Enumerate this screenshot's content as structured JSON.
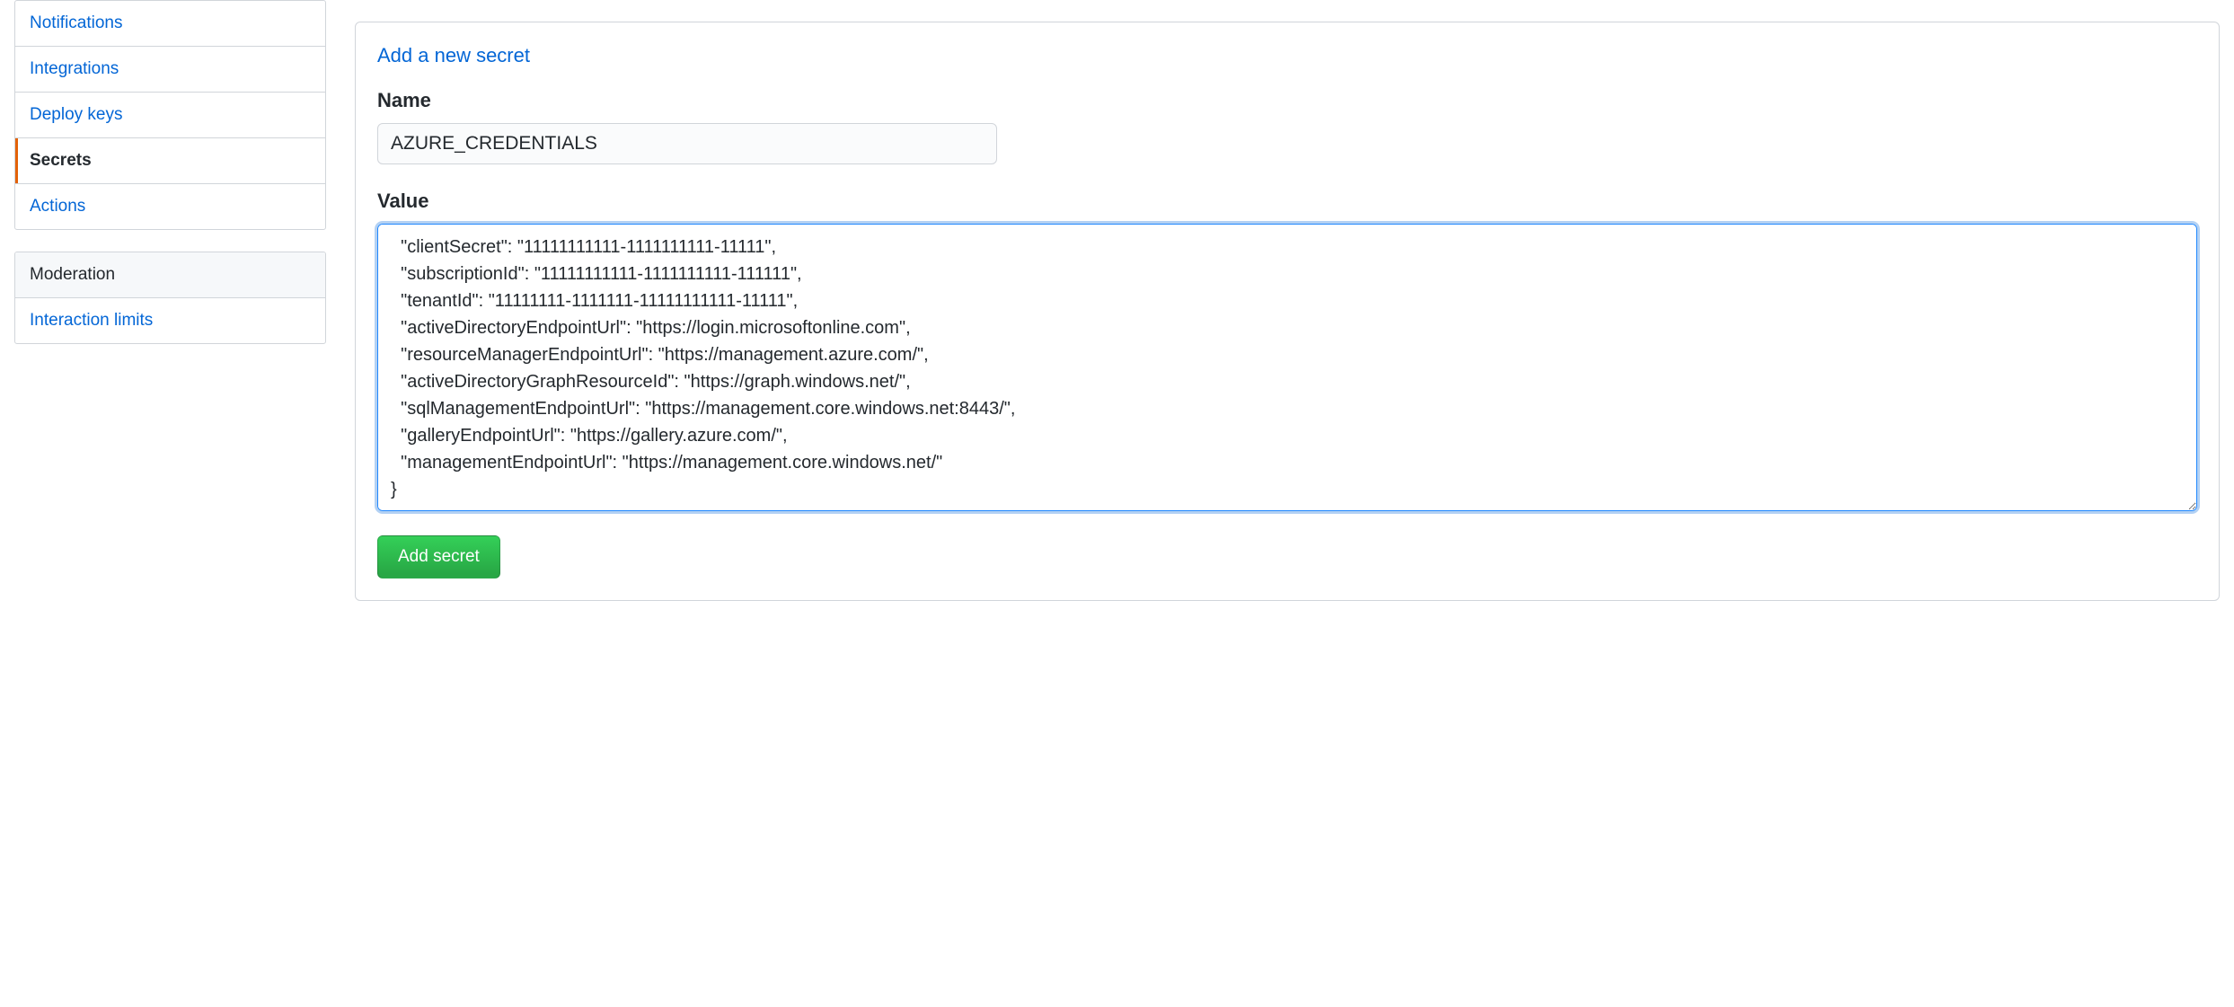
{
  "sidebar": {
    "primary": [
      {
        "label": "Notifications",
        "active": false
      },
      {
        "label": "Integrations",
        "active": false
      },
      {
        "label": "Deploy keys",
        "active": false
      },
      {
        "label": "Secrets",
        "active": true
      },
      {
        "label": "Actions",
        "active": false
      }
    ],
    "moderation_header": "Moderation",
    "moderation": [
      {
        "label": "Interaction limits",
        "active": false
      }
    ]
  },
  "form": {
    "title": "Add a new secret",
    "name_label": "Name",
    "name_value": "AZURE_CREDENTIALS",
    "value_label": "Value",
    "value_text": "  \"clientSecret\": \"11111111111-1111111111-11111\",\n  \"subscriptionId\": \"11111111111-1111111111-111111\",\n  \"tenantId\": \"11111111-1111111-11111111111-11111\",\n  \"activeDirectoryEndpointUrl\": \"https://login.microsoftonline.com\",\n  \"resourceManagerEndpointUrl\": \"https://management.azure.com/\",\n  \"activeDirectoryGraphResourceId\": \"https://graph.windows.net/\",\n  \"sqlManagementEndpointUrl\": \"https://management.core.windows.net:8443/\",\n  \"galleryEndpointUrl\": \"https://gallery.azure.com/\",\n  \"managementEndpointUrl\": \"https://management.core.windows.net/\"\n}",
    "submit_label": "Add secret"
  }
}
